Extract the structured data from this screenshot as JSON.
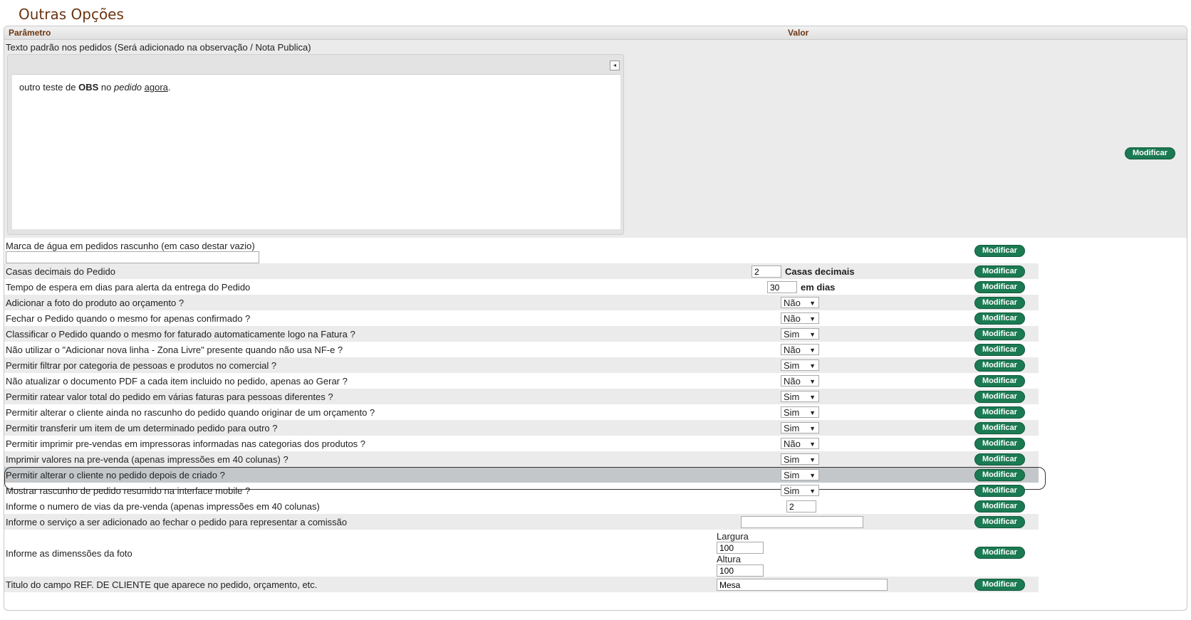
{
  "page_title": "Outras Opções",
  "header": {
    "param": "Parâmetro",
    "valor": "Valor"
  },
  "editor": {
    "label": "Texto padrão nos pedidos (Será adicionado na observação / Nota Publica)",
    "toggle": "◂",
    "content_part1": "outro teste de ",
    "content_bold": "OBS",
    "content_part2": " no ",
    "content_italic": "pedido",
    "content_part3": " ",
    "content_underline": "agora",
    "content_end": "."
  },
  "button_label": "Modificar",
  "watermark": {
    "label": "Marca de água em pedidos rascunho (em caso destar vazio)",
    "value": ""
  },
  "decimais": {
    "label": "Casas decimais do Pedido",
    "value": "2",
    "suffix": "Casas decimais"
  },
  "espera": {
    "label": "Tempo de espera em dias para alerta da entrega do Pedido",
    "value": "30",
    "suffix": "em dias"
  },
  "options": [
    {
      "label": "Adicionar a foto do produto ao orçamento ?",
      "value": "Não"
    },
    {
      "label": "Fechar o Pedido quando o mesmo for apenas confirmado ?",
      "value": "Não"
    },
    {
      "label": "Classificar o Pedido quando o mesmo for faturado automaticamente logo na Fatura ?",
      "value": "Sim"
    },
    {
      "label": "Não utilizar o \"Adicionar nova linha - Zona Livre\" presente quando não usa NF-e ?",
      "value": "Não"
    },
    {
      "label": "Permitir filtrar por categoria de pessoas e produtos no comercial ?",
      "value": "Sim"
    },
    {
      "label": "Não atualizar o documento PDF a cada item incluido no pedido, apenas ao Gerar ?",
      "value": "Não"
    },
    {
      "label": "Permitir ratear valor total do pedido em várias faturas para pessoas diferentes ?",
      "value": "Sim"
    },
    {
      "label": "Permitir alterar o cliente ainda no rascunho do pedido quando originar de um orçamento ?",
      "value": "Sim"
    },
    {
      "label": "Permitir transferir um item de um determinado pedido para outro ?",
      "value": "Sim"
    },
    {
      "label": "Permitir imprimir pre-vendas em impressoras informadas nas categorias dos produtos ?",
      "value": "Não"
    },
    {
      "label": "Imprimir valores na pre-venda (apenas impressões em 40 colunas) ?",
      "value": "Sim"
    },
    {
      "label": "Permitir alterar o cliente no pedido depois de criado ?",
      "value": "Sim"
    },
    {
      "label": "Mostrar rascunho de pedido resumido na interface mobile ?",
      "value": "Sim"
    }
  ],
  "vias": {
    "label": "Informe o numero de vias da pre-venda (apenas impressões em 40 colunas)",
    "value": "2"
  },
  "servico": {
    "label": "Informe o serviço a ser adicionado ao fechar o pedido para representar a comissão",
    "value": ""
  },
  "dimensoes": {
    "label": "Informe as dimenssões da foto",
    "largura_label": "Largura",
    "largura": "100",
    "altura_label": "Altura",
    "altura": "100"
  },
  "ref_cliente": {
    "label": "Titulo do campo REF. DE CLIENTE que aparece no pedido, orçamento, etc.",
    "value": "Mesa"
  },
  "colors": {
    "title": "#6b3510",
    "button": "#1b7a52",
    "row_alt": "#ebebeb",
    "row_highlight": "#c3c7c9"
  }
}
